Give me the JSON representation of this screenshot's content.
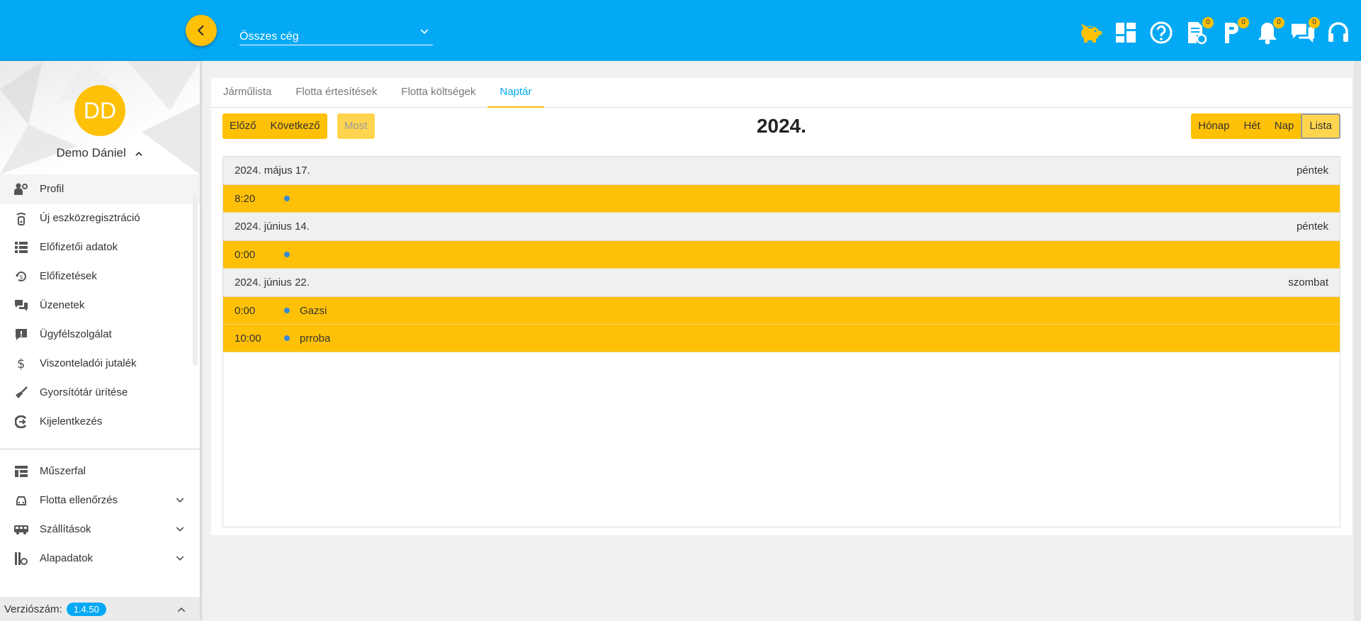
{
  "header": {
    "company_select": "Összes cég",
    "badges": {
      "documents": "0",
      "parking": "0",
      "notifications": "0",
      "messages": "0"
    }
  },
  "user": {
    "initials": "DD",
    "name": "Demo Dániel"
  },
  "menu": {
    "profile": "Profil",
    "device_registration": "Új eszközregisztráció",
    "subscriber_data": "Előfizetői adatok",
    "subscriptions": "Előfizetések",
    "messages": "Üzenetek",
    "support": "Ügyfélszolgálat",
    "reseller": "Viszonteladói jutalék",
    "clear_cache": "Gyorsítótár ürítése",
    "logout": "Kijelentkezés",
    "dashboard": "Műszerfal",
    "fleet_check": "Flotta ellenőrzés",
    "transports": "Szállítások",
    "basic_data": "Alapadatok"
  },
  "version": {
    "label": "Verziószám:",
    "value": "1.4.50"
  },
  "tabs": {
    "vehicles": "Járműlista",
    "notifications": "Flotta értesítések",
    "costs": "Flotta költségek",
    "calendar": "Naptár"
  },
  "toolbar": {
    "prev": "Előző",
    "next": "Következő",
    "now": "Most",
    "title": "2024.",
    "month": "Hónap",
    "week": "Hét",
    "day": "Nap",
    "list": "Lista"
  },
  "days": [
    {
      "date": "2024. május 17.",
      "weekday": "péntek",
      "events": [
        {
          "time": "8:20",
          "title": ""
        }
      ]
    },
    {
      "date": "2024. június 14.",
      "weekday": "péntek",
      "events": [
        {
          "time": "0:00",
          "title": ""
        }
      ]
    },
    {
      "date": "2024. június 22.",
      "weekday": "szombat",
      "events": [
        {
          "time": "0:00",
          "title": "Gazsi"
        },
        {
          "time": "10:00",
          "title": "prroba"
        }
      ]
    }
  ],
  "colors": {
    "primary": "#03a9f4",
    "accent": "#ffc107",
    "event_dot": "#3788d8"
  }
}
